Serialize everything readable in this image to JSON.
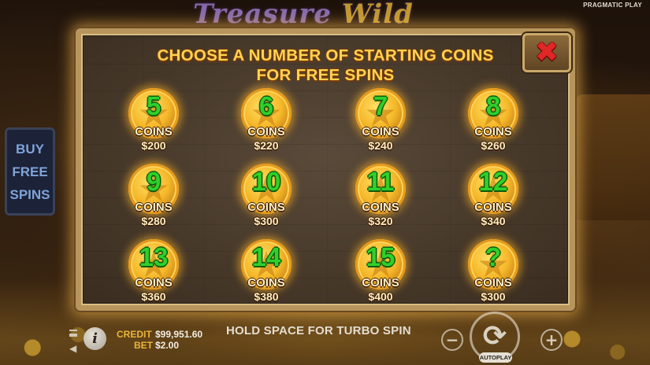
{
  "game": {
    "logo_part1": "Treasure",
    "logo_part2": "Wild",
    "provider": "PRAGMATIC PLAY"
  },
  "side_panel": {
    "buy_free_spins": "BUY\nFREE\nSPINS"
  },
  "modal": {
    "title_line1": "CHOOSE A NUMBER OF STARTING COINS",
    "title_line2": "FOR FREE SPINS",
    "close_symbol": "✖",
    "coin_unit_label": "COINS",
    "options": [
      {
        "coins": "5",
        "price": "$200"
      },
      {
        "coins": "6",
        "price": "$220"
      },
      {
        "coins": "7",
        "price": "$240"
      },
      {
        "coins": "8",
        "price": "$260"
      },
      {
        "coins": "9",
        "price": "$280"
      },
      {
        "coins": "10",
        "price": "$300"
      },
      {
        "coins": "11",
        "price": "$320"
      },
      {
        "coins": "12",
        "price": "$340"
      },
      {
        "coins": "13",
        "price": "$360"
      },
      {
        "coins": "14",
        "price": "$380"
      },
      {
        "coins": "15",
        "price": "$400"
      },
      {
        "coins": "?",
        "price": "$300"
      }
    ]
  },
  "bottom_bar": {
    "info_symbol": "i",
    "credit_label": "CREDIT",
    "credit_value": "$99,951.60",
    "bet_label": "BET",
    "bet_value": "$2.00",
    "message": "HOLD SPACE FOR TURBO SPIN",
    "minus_symbol": "−",
    "plus_symbol": "+",
    "spin_symbol": "⟳",
    "autoplay_label": "AUTOPLAY"
  },
  "colors": {
    "title_gold": "#ffd451",
    "coin_number_green": "#2fd02c",
    "close_red": "#e02626",
    "balance_label": "#e9b53a"
  },
  "icons": [
    "menu-icon",
    "sound-icon",
    "info-icon",
    "close-icon",
    "spin-arrows-icon",
    "star-icon"
  ]
}
